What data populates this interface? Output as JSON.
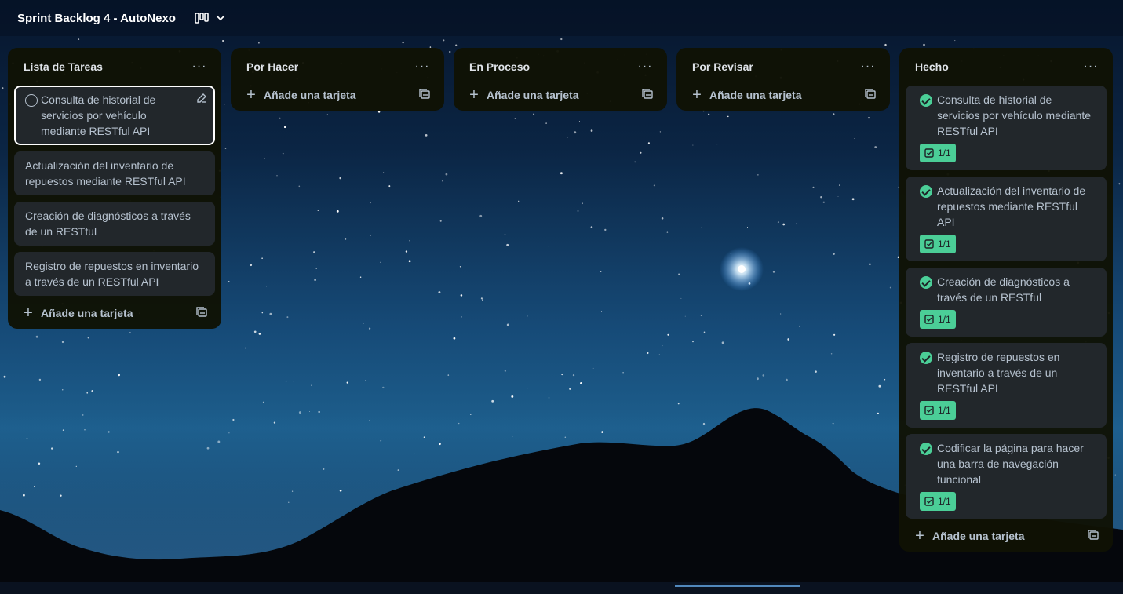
{
  "board": {
    "title": "Sprint Backlog 4 - AutoNexo",
    "view_icon": "board-view-icon",
    "chevron_icon": "chevron-down-icon"
  },
  "colors": {
    "list_bg": "#101204",
    "card_bg": "#22272b",
    "text": "#b6c2cf",
    "done_badge": "#4bce97"
  },
  "lists": [
    {
      "title": "Lista de Tareas",
      "cards": [
        {
          "text": "Consulta de historial de servicios por vehículo mediante RESTful API"
        },
        {
          "text": "Actualización del inventario de repuestos mediante RESTful API"
        },
        {
          "text": "Creación de diagnósticos a través de un RESTful"
        },
        {
          "text": "Registro de repuestos en inventario a través de un RESTful API"
        }
      ],
      "add_label": "Añade una tarjeta"
    },
    {
      "title": "Por Hacer",
      "cards": [],
      "add_label": "Añade una tarjeta"
    },
    {
      "title": "En Proceso",
      "cards": [],
      "add_label": "Añade una tarjeta"
    },
    {
      "title": "Por Revisar",
      "cards": [],
      "add_label": "Añade una tarjeta"
    },
    {
      "title": "Hecho",
      "cards": [
        {
          "text": "Consulta de historial de servicios por vehículo mediante RESTful API",
          "checklist": "1/1"
        },
        {
          "text": "Actualización del inventario de repuestos mediante RESTful API",
          "checklist": "1/1"
        },
        {
          "text": "Creación de diagnósticos a través de un RESTful",
          "checklist": "1/1"
        },
        {
          "text": "Registro de repuestos en inventario a través de un RESTful API",
          "checklist": "1/1"
        },
        {
          "text": "Codificar la página para hacer una barra de navegación funcional",
          "checklist": "1/1"
        }
      ],
      "add_label": "Añade una tarjeta"
    }
  ]
}
